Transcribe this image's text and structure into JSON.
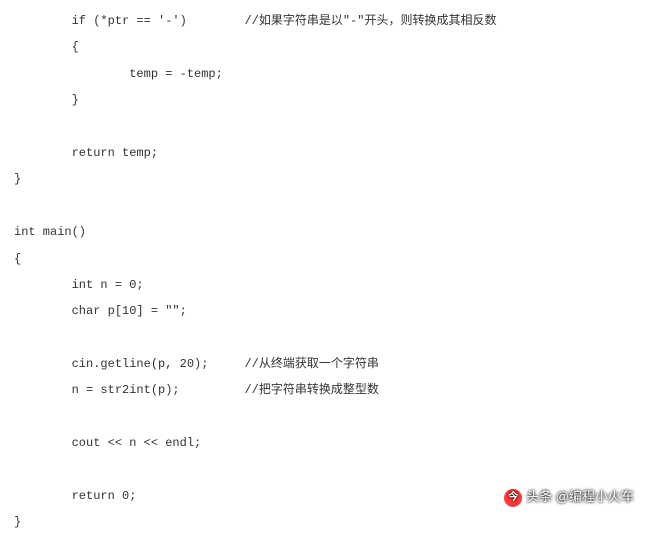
{
  "code": {
    "l1": "        if (*ptr == '-')        //如果字符串是以\"-\"开头，则转换成其相反数",
    "l2": "        {",
    "l3": "                temp = -temp;",
    "l4": "        }",
    "l5": "",
    "l6": "        return temp;",
    "l7": "}",
    "l8": "",
    "l9": "int main()",
    "l10": "{",
    "l11": "        int n = 0;",
    "l12": "        char p[10] = \"\";",
    "l13": "",
    "l14": "        cin.getline(p, 20);     //从终端获取一个字符串",
    "l15": "        n = str2int(p);         //把字符串转换成整型数",
    "l16": "",
    "l17": "        cout << n << endl;",
    "l18": "",
    "l19": "        return 0;",
    "l20": "}"
  },
  "watermark": {
    "icon": "今",
    "text": "头条 @编程小火车"
  }
}
